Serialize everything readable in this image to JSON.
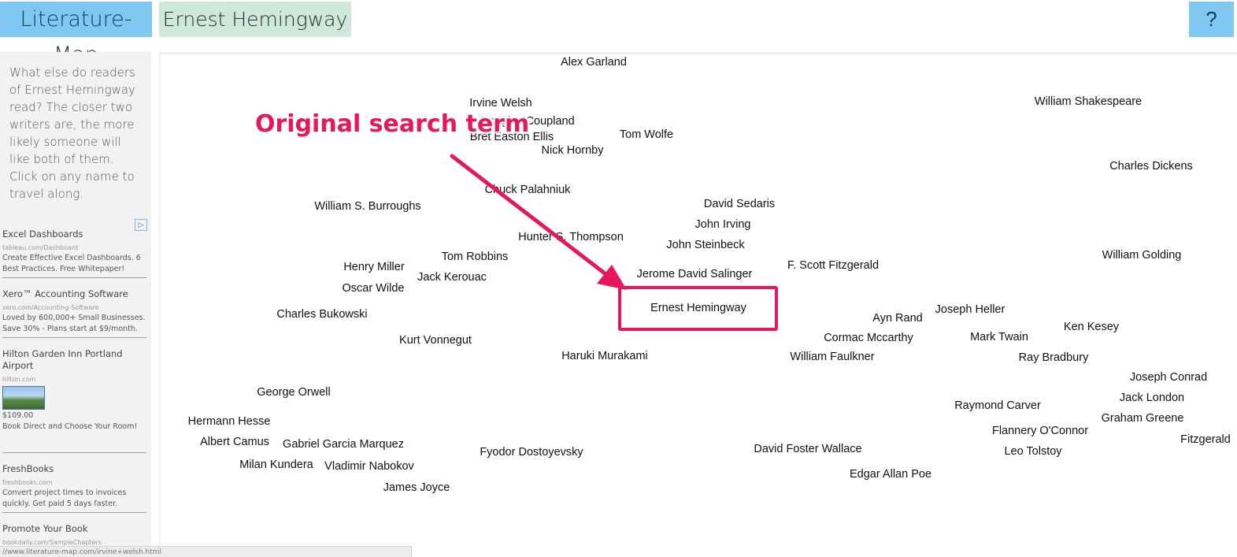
{
  "header": {
    "logo": "Literature-Map",
    "author": "Ernest Hemingway",
    "help": "?"
  },
  "sidebar": {
    "intro": "What else do readers of Ernest Hemingway read? The closer two writers are, the more likely someone will like both of them. Click on any name to travel along.",
    "adchoices_icon": "adchoices-icon",
    "ads": [
      {
        "title": "Excel Dashboards",
        "url": "tableau.com/Dashboard",
        "desc": "Create Effective Excel Dashboards. 6 Best Practices. Free Whitepaper!"
      },
      {
        "title": "Xero™ Accounting Software",
        "url": "xero.com/Accounting-Software",
        "desc": "Loved by 600,000+ Small Businesses. Save 30% - Plans start at $9/month."
      },
      {
        "title": "Hilton Garden Inn Portland Airport",
        "url": "hilton.com",
        "price": "$109.00",
        "desc": "Book Direct and Choose Your Room!"
      },
      {
        "title": "FreshBooks",
        "url": "freshbooks.com",
        "desc": "Convert project times to invoices quickly. Get paid 5 days faster."
      },
      {
        "title": "Promote Your Book",
        "url": "bookdaily.com/SampleChapters",
        "desc": ""
      }
    ]
  },
  "map": {
    "authors": [
      "Alex Garland",
      "Irvine Welsh",
      "Douglas Coupland",
      "Bret Easton Ellis",
      "Tom Wolfe",
      "Nick Hornby",
      "Chuck Palahniuk",
      "William S. Burroughs",
      "David Sedaris",
      "John Irving",
      "Hunter S. Thompson",
      "John Steinbeck",
      "Tom Robbins",
      "Henry Miller",
      "Jack Kerouac",
      "Oscar Wilde",
      "Jerome David Salinger",
      "F. Scott Fitzgerald",
      "Charles Bukowski",
      "Ernest Hemingway",
      "Kurt Vonnegut",
      "Haruki Murakami",
      "Ayn Rand",
      "Joseph Heller",
      "Cormac Mccarthy",
      "Mark Twain",
      "William Faulkner",
      "Ken Kesey",
      "Ray Bradbury",
      "William Shakespeare",
      "Charles Dickens",
      "William Golding",
      "Joseph Conrad",
      "Jack London",
      "Graham Greene",
      "Fitzgerald",
      "George Orwell",
      "Hermann Hesse",
      "Albert Camus",
      "Gabriel Garcia Marquez",
      "Fyodor Dostoyevsky",
      "David Foster Wallace",
      "Raymond Carver",
      "Flannery O'Connor",
      "Leo Tolstoy",
      "Milan Kundera",
      "Vladimir Nabokov",
      "Edgar Allan Poe",
      "James Joyce"
    ]
  },
  "annotation": {
    "text": "Original search term",
    "color": "#e8175d"
  },
  "statusbar": {
    "url": "//www.literature-map.com/irvine+welsh.html"
  }
}
